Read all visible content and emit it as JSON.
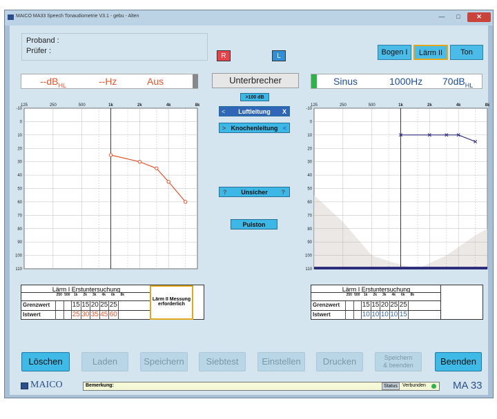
{
  "window": {
    "title": "MAICO MA33 Speech Tonaudiometrie V3.1 -      gebu  - Alten",
    "min": "—",
    "max": "□",
    "close": "✕"
  },
  "patient": {
    "proband_label": "Proband :",
    "pruefer_label": "Prüfer    :"
  },
  "ear_buttons": {
    "right": "R",
    "left": "L"
  },
  "top_buttons": {
    "bogen": "Bogen I",
    "laerm": "Lärm II",
    "ton": "Ton"
  },
  "left_display": {
    "db": "--dB",
    "db_sub": "HL",
    "hz": "--Hz",
    "mode": "Aus"
  },
  "interrupter": "Unterbrecher",
  "right_display": {
    "signal": "Sinus",
    "freq": "1000",
    "freq_unit": "Hz",
    "level": "70",
    "level_unit": "dB",
    "level_sub": "HL"
  },
  "mid_controls": {
    "over100": ">100 dB",
    "luft": "Luftleitung",
    "luft_left": "<",
    "luft_right": "X",
    "knochen": "Knochenleitung",
    "knochen_left": ">",
    "knochen_right": "<",
    "unsicher": "Unsicher",
    "unsicher_q": "?",
    "pulston": "Pulston"
  },
  "freq_labels": [
    "125",
    "250",
    "500",
    "1k",
    "2k",
    "4k",
    "8k"
  ],
  "db_labels": [
    "-10",
    "0",
    "10",
    "20",
    "30",
    "40",
    "50",
    "60",
    "70",
    "80",
    "90",
    "100",
    "110"
  ],
  "chart_data": [
    {
      "type": "line",
      "ear": "right",
      "title": "",
      "x": [
        1000,
        2000,
        3000,
        4000,
        6000
      ],
      "y": [
        25,
        30,
        35,
        45,
        60
      ],
      "xlim": [
        125,
        8000
      ],
      "ylim": [
        -10,
        110
      ],
      "color": "#e4542a",
      "marker": "circle"
    },
    {
      "type": "line",
      "ear": "left",
      "title": "",
      "x": [
        1000,
        2000,
        3000,
        4000,
        6000
      ],
      "y": [
        10,
        10,
        10,
        10,
        15
      ],
      "xlim": [
        125,
        8000
      ],
      "ylim": [
        -10,
        110
      ],
      "color": "#2b2b7a",
      "marker": "x",
      "masking_band": true
    }
  ],
  "table_left": {
    "title": "Lärm I Erstuntersuchung",
    "freqs": [
      "250",
      "500",
      "1k",
      "2k",
      "3k",
      "4k",
      "6k",
      "8k"
    ],
    "row1_label": "Grenzwert",
    "row1": [
      "",
      "",
      "15",
      "15",
      "20",
      "25",
      "25",
      ""
    ],
    "row2_label": "Istwert",
    "row2": [
      "",
      "",
      "25",
      "30",
      "35",
      "45",
      "60",
      ""
    ],
    "note": "Lärm II Messung erforderlich"
  },
  "table_right": {
    "title": "Lärm I Erstuntersuchung",
    "freqs": [
      "250",
      "500",
      "1k",
      "2k",
      "3k",
      "4k",
      "6k",
      "8k"
    ],
    "row1_label": "Grenzwert",
    "row1": [
      "",
      "",
      "15",
      "15",
      "20",
      "25",
      "25",
      ""
    ],
    "row2_label": "Istwert",
    "row2": [
      "",
      "",
      "10",
      "10",
      "10",
      "10",
      "15",
      ""
    ]
  },
  "bottom_buttons": {
    "loeschen": "Löschen",
    "laden": "Laden",
    "speichern": "Speichern",
    "siebtest": "Siebtest",
    "einstellen": "Einstellen",
    "drucken": "Drucken",
    "speichern_beenden_1": "Speichern",
    "speichern_beenden_2": "& beenden",
    "beenden": "Beenden"
  },
  "status": {
    "brand": "MAICO",
    "remark_label": "Bemerkung:",
    "status_label": "Status",
    "connected": "Verbunden",
    "model": "MA 33"
  }
}
